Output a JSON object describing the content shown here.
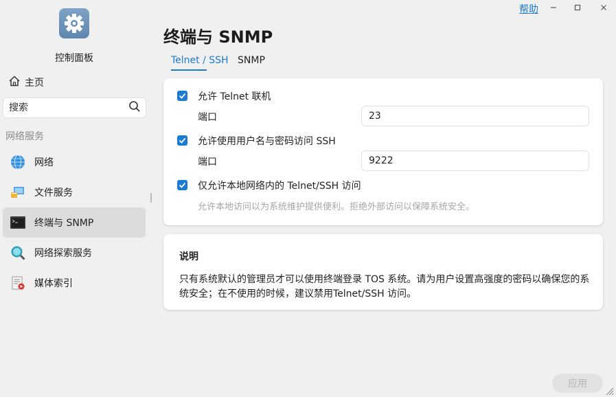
{
  "window": {
    "help_label": "帮助"
  },
  "sidebar": {
    "app_title": "控制面板",
    "home_label": "主页",
    "search": {
      "placeholder": "搜索"
    },
    "section_label": "网络服务",
    "items": [
      {
        "label": "网络",
        "icon": "globe-icon",
        "active": false
      },
      {
        "label": "文件服务",
        "icon": "file-service-icon",
        "active": false
      },
      {
        "label": "终端与 SNMP",
        "icon": "terminal-icon",
        "active": true
      },
      {
        "label": "网络探索服务",
        "icon": "magnifier-icon",
        "active": false
      },
      {
        "label": "媒体索引",
        "icon": "media-index-icon",
        "active": false
      }
    ]
  },
  "main": {
    "title": "终端与 SNMP",
    "tabs": [
      {
        "label": "Telnet / SSH",
        "active": true
      },
      {
        "label": "SNMP",
        "active": false
      }
    ],
    "settings": {
      "telnet_label": "允许 Telnet 联机",
      "telnet_checked": true,
      "telnet_port_label": "端口",
      "telnet_port_value": "23",
      "ssh_label": "允许使用用户名与密码访问 SSH",
      "ssh_checked": true,
      "ssh_port_label": "端口",
      "ssh_port_value": "9222",
      "local_only_label": "仅允许本地网络内的 Telnet/SSH 访问",
      "local_only_checked": true,
      "local_only_hint": "允许本地访问以为系统维护提供便利。拒绝外部访问以保障系统安全。"
    },
    "info": {
      "title": "说明",
      "text": "只有系统默认的管理员才可以使用终端登录 TOS 系统。请为用户设置高强度的密码以确保您的系统安全；在不使用的时候，建议禁用Telnet/SSH 访问。"
    },
    "apply_label": "应用"
  },
  "colors": {
    "accent": "#1a7ad4",
    "background": "#f0f0f0",
    "card": "#ffffff",
    "active_nav": "#dcdcdc"
  }
}
